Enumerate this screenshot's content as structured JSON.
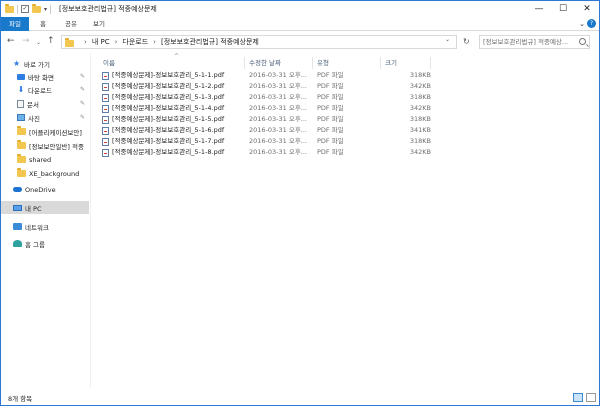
{
  "window": {
    "title": "[정보보호관리법규] 적중예상문제",
    "minimize": "—",
    "maximize": "☐",
    "close": "✕"
  },
  "ribbon": {
    "tabs": [
      "파일",
      "홈",
      "공유",
      "보기"
    ],
    "toggle": "⌄",
    "help": "?"
  },
  "nav": {
    "back": "←",
    "forward": "→",
    "recent": "⌄",
    "up": "↑",
    "breadcrumb": [
      "내 PC",
      "다운로드",
      "[정보보호관리법규] 적중예상문제"
    ],
    "address_dropdown": "⌄",
    "refresh": "↻",
    "search_placeholder": "[정보보호관리법규] 적중예상..."
  },
  "sidebar": {
    "items": [
      {
        "label": "바로 가기",
        "icon": "star-icon",
        "pinned": false
      },
      {
        "label": "바탕 화면",
        "icon": "desktop-icon",
        "pinned": true
      },
      {
        "label": "다운로드",
        "icon": "download-icon",
        "pinned": true
      },
      {
        "label": "문서",
        "icon": "documents-icon",
        "pinned": true
      },
      {
        "label": "사진",
        "icon": "pictures-icon",
        "pinned": true
      },
      {
        "label": "[어플리케이션보안]",
        "icon": "folder-icon",
        "pinned": false
      },
      {
        "label": "[정보보안일반] 적중",
        "icon": "folder-icon",
        "pinned": false
      },
      {
        "label": "shared",
        "icon": "folder-icon",
        "pinned": false
      },
      {
        "label": "XE_background",
        "icon": "folder-icon",
        "pinned": false
      },
      {
        "label": "OneDrive",
        "icon": "onedrive-icon",
        "pinned": false
      },
      {
        "label": "내 PC",
        "icon": "pc-icon",
        "pinned": false
      },
      {
        "label": "네트워크",
        "icon": "network-icon",
        "pinned": false
      },
      {
        "label": "홈 그룹",
        "icon": "homegroup-icon",
        "pinned": false
      }
    ],
    "pin_glyph": "✎",
    "star_glyph": "★",
    "download_glyph": "⬇"
  },
  "list": {
    "sort_caret": "^",
    "columns": [
      "이름",
      "수정한 날짜",
      "유형",
      "크기"
    ],
    "files": [
      {
        "name": "[적중예상문제]-정보보호관리_5-1-1.pdf",
        "date": "2016-03-31 오후...",
        "type": "PDF 파일",
        "size": "318KB"
      },
      {
        "name": "[적중예상문제]-정보보호관리_5-1-2.pdf",
        "date": "2016-03-31 오후...",
        "type": "PDF 파일",
        "size": "342KB"
      },
      {
        "name": "[적중예상문제]-정보보호관리_5-1-3.pdf",
        "date": "2016-03-31 오후...",
        "type": "PDF 파일",
        "size": "318KB"
      },
      {
        "name": "[적중예상문제]-정보보호관리_5-1-4.pdf",
        "date": "2016-03-31 오후...",
        "type": "PDF 파일",
        "size": "342KB"
      },
      {
        "name": "[적중예상문제]-정보보호관리_5-1-5.pdf",
        "date": "2016-03-31 오후...",
        "type": "PDF 파일",
        "size": "318KB"
      },
      {
        "name": "[적중예상문제]-정보보호관리_5-1-6.pdf",
        "date": "2016-03-31 오후...",
        "type": "PDF 파일",
        "size": "341KB"
      },
      {
        "name": "[적중예상문제]-정보보호관리_5-1-7.pdf",
        "date": "2016-03-31 오후...",
        "type": "PDF 파일",
        "size": "318KB"
      },
      {
        "name": "[적중예상문제]-정보보호관리_5-1-8.pdf",
        "date": "2016-03-31 오후...",
        "type": "PDF 파일",
        "size": "342KB"
      }
    ]
  },
  "status": {
    "item_count": "8개 항목"
  },
  "colors": {
    "accent": "#1979ca",
    "selected": "#d9d9d9",
    "header_text": "#4c607a"
  }
}
